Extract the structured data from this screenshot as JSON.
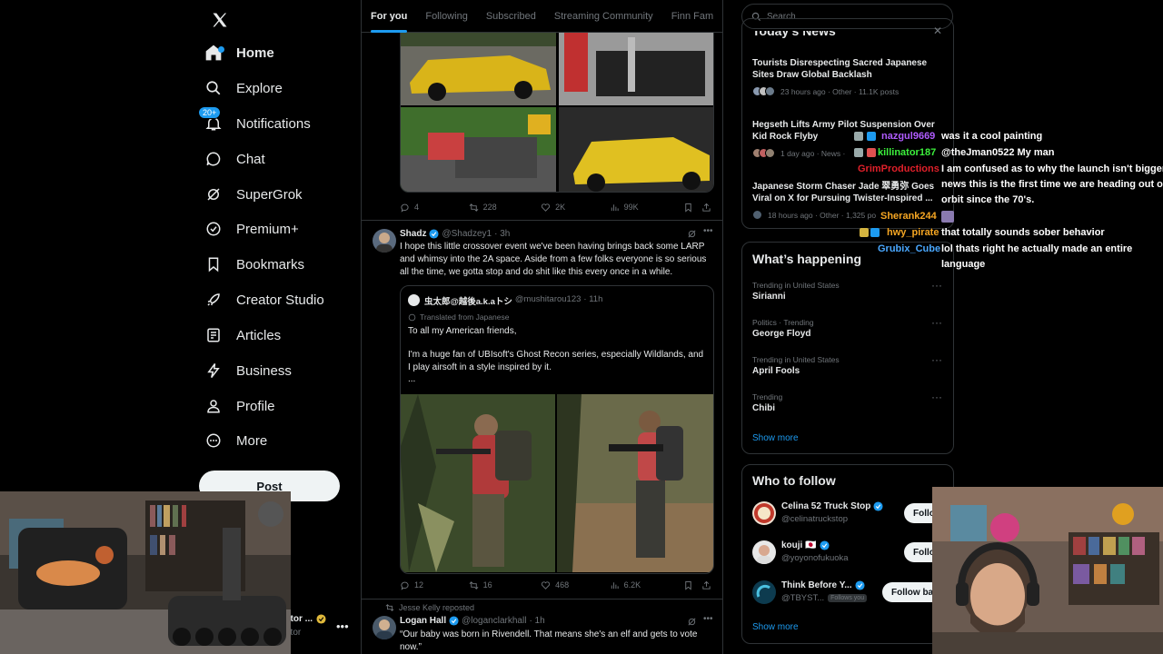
{
  "nav": {
    "items": [
      {
        "label": "Home",
        "icon": "home-icon"
      },
      {
        "label": "Explore",
        "icon": "search-icon"
      },
      {
        "label": "Notifications",
        "icon": "bell-icon",
        "badge": "20+"
      },
      {
        "label": "Chat",
        "icon": "chat-icon"
      },
      {
        "label": "SuperGrok",
        "icon": "grok-icon"
      },
      {
        "label": "Premium+",
        "icon": "premium-icon"
      },
      {
        "label": "Bookmarks",
        "icon": "bookmark-icon"
      },
      {
        "label": "Creator Studio",
        "icon": "rocket-icon"
      },
      {
        "label": "Articles",
        "icon": "article-icon"
      },
      {
        "label": "Business",
        "icon": "lightning-icon"
      },
      {
        "label": "Profile",
        "icon": "person-icon"
      },
      {
        "label": "More",
        "icon": "more-circle-icon"
      }
    ],
    "post_label": "Post",
    "account_name": "ator ...",
    "account_handle": "ator"
  },
  "timeline": {
    "tabs": [
      "For you",
      "Following",
      "Subscribed",
      "Streaming Community",
      "Finn Fam"
    ],
    "active_tab": "For you",
    "tweet1_actions": {
      "replies": "4",
      "reposts": "228",
      "likes": "2K",
      "views": "99K"
    },
    "tweet2": {
      "name": "Shadz",
      "handle": "@Shadzey1",
      "time": "· 3h",
      "text": "I hope this little crossover event we've been having brings back some LARP and whimsy into the 2A space. Aside from a few folks everyone is so serious all the time, we gotta stop and do shit like this every once in a while.",
      "quote": {
        "name": "虫太郎@越後a.k.aトシ",
        "handle": "@mushitarou123",
        "time": "· 11h",
        "translated": "Translated from Japanese",
        "line1": "To all my American friends,",
        "line2": "I'm a huge fan of UBIsoft's Ghost Recon series, especially Wildlands, and I play airsoft in a style inspired by it.",
        "line3": "..."
      },
      "actions": {
        "replies": "12",
        "reposts": "16",
        "likes": "468",
        "views": "6.2K"
      }
    },
    "tweet3": {
      "repost_label": "Jesse Kelly reposted",
      "name": "Logan Hall",
      "handle": "@loganclarkhall",
      "time": "· 1h",
      "text": "“Our baby was born in Rivendell. That means she's an elf and gets to vote now.”"
    }
  },
  "right": {
    "search_placeholder": "Search",
    "news_header": "Today's News",
    "news": [
      {
        "title": "Tourists Disrespecting Sacred Japanese Sites Draw Global Backlash",
        "meta": "23 hours ago · Other · 11.1K posts"
      },
      {
        "title": "Hegseth Lifts Army Pilot Suspension Over Kid Rock Flyby",
        "meta": "1 day ago · News ·"
      },
      {
        "title": "Japanese Storm Chaser Jade 翠勇弥 Goes Viral on X for Pursuing Twister-Inspired ...",
        "meta": "18 hours ago · Other · 1,325 po"
      }
    ],
    "happening_title": "What’s happening",
    "trends": [
      {
        "meta": "Trending in United States",
        "name": "Sirianni"
      },
      {
        "meta": "Politics · Trending",
        "name": "George Floyd"
      },
      {
        "meta": "Trending in United States",
        "name": "April Fools"
      },
      {
        "meta": "Trending",
        "name": "Chibi"
      }
    ],
    "show_more": "Show more",
    "wtf_title": "Who to follow",
    "wtf": [
      {
        "name": "Celina 52 Truck Stop",
        "handle": "@celinatruckstop",
        "button": "Follow"
      },
      {
        "name": "kouji 🇯🇵",
        "handle": "@yoyonofukuoka",
        "button": "Follow"
      },
      {
        "name": "Think Before Y...",
        "handle": "@TBYST...",
        "follows_you": "Follows you",
        "button": "Follow back"
      }
    ],
    "wtf_show_more": "Show more"
  },
  "chat": [
    {
      "user": "nazgul9669",
      "color": "#b05cff",
      "msg": "was it a cool painting"
    },
    {
      "user": "killinator187",
      "color": "#3cf03c",
      "msg": "@theJman0522 My man"
    },
    {
      "user": "GrimProductions",
      "color": "#e0202a",
      "msg": "I am confused as to why the launch isn't bigger"
    },
    {
      "user": "",
      "color": "#fff",
      "msg": "news this is the first time we are heading out of"
    },
    {
      "user": "",
      "color": "#fff",
      "msg": "orbit since the 70's."
    },
    {
      "user": "Sherank244",
      "color": "#f5a623",
      "msg": ""
    },
    {
      "user": "hwy_pirate",
      "color": "#f5a623",
      "msg": "that totally sounds sober behavior"
    },
    {
      "user": "Grubix_Cube",
      "color": "#4aa8ff",
      "msg": "lol thats right he actually made an entire"
    },
    {
      "user": "",
      "color": "#fff",
      "msg": "language"
    }
  ],
  "colors": {
    "accent": "#1d9bf0",
    "bg": "#000000",
    "border": "#2f3336",
    "muted": "#71767b"
  }
}
